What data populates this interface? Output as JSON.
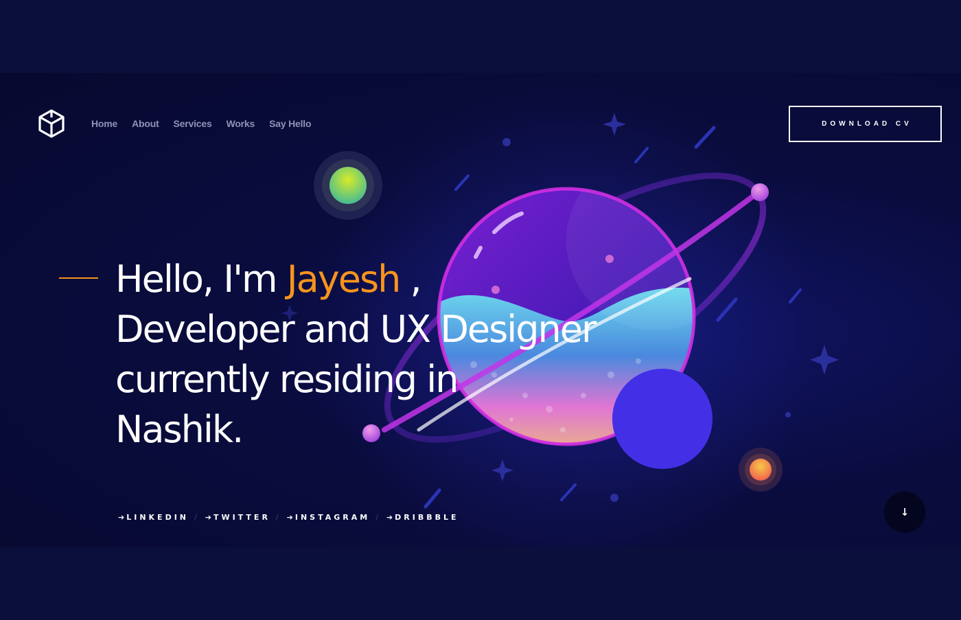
{
  "nav": {
    "items": [
      {
        "label": "Home"
      },
      {
        "label": "About"
      },
      {
        "label": "Services"
      },
      {
        "label": "Works"
      },
      {
        "label": "Say Hello"
      }
    ]
  },
  "header": {
    "cv_button": "DOWNLOAD CV"
  },
  "hero": {
    "greeting": "Hello, I'm ",
    "name": "Jayesh",
    "comma": " ,",
    "line2": "Developer and UX Designer",
    "line3": "currently residing in",
    "line4": "Nashik."
  },
  "social": {
    "arrow": "➔",
    "links": [
      {
        "label": "LINKEDIN"
      },
      {
        "label": "TWITTER"
      },
      {
        "label": "INSTAGRAM"
      },
      {
        "label": "DRIBBBLE"
      }
    ],
    "separator": "/"
  },
  "scroll": {
    "icon": "↓"
  },
  "icons": {
    "logo": "cube-logo-icon",
    "scroll": "arrow-down-icon"
  },
  "colors": {
    "accent": "#f7941d",
    "background": "#0b0f3b",
    "text": "#ffffff",
    "nav_text": "#8f93b8"
  }
}
